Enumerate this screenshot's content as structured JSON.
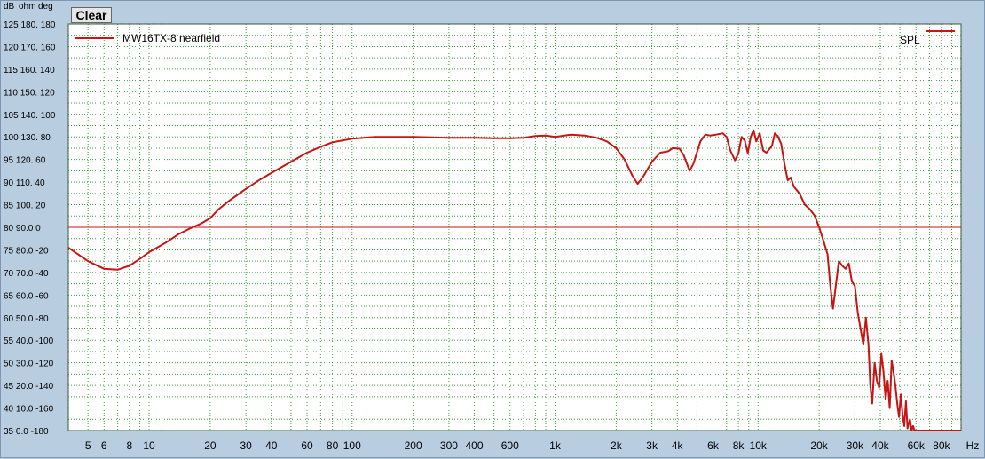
{
  "toolbar": {
    "clear_label": "Clear"
  },
  "axis_headers": {
    "db": "dB",
    "ohm": "ohm",
    "deg": "deg"
  },
  "colors": {
    "background": "#b9cde0",
    "grid": "#1a8a1a",
    "series": "#c81414",
    "reference_line": "#c81414"
  },
  "chart_data": {
    "type": "line",
    "x_scale": "log",
    "xlim": [
      4,
      100000
    ],
    "ylim": [
      35,
      125
    ],
    "grid": true,
    "legend_left": "MW16TX-8 nearfield",
    "legend_right": "SPL",
    "x_tick_labels": [
      {
        "value": 5,
        "label": "5"
      },
      {
        "value": 6,
        "label": "6"
      },
      {
        "value": 8,
        "label": "8"
      },
      {
        "value": 10,
        "label": "10"
      },
      {
        "value": 20,
        "label": "20"
      },
      {
        "value": 30,
        "label": "30"
      },
      {
        "value": 40,
        "label": "40"
      },
      {
        "value": 60,
        "label": "60"
      },
      {
        "value": 80,
        "label": "80"
      },
      {
        "value": 100,
        "label": "100"
      },
      {
        "value": 200,
        "label": "200"
      },
      {
        "value": 300,
        "label": "300"
      },
      {
        "value": 400,
        "label": "400"
      },
      {
        "value": 600,
        "label": "600"
      },
      {
        "value": 1000,
        "label": "1k"
      },
      {
        "value": 2000,
        "label": "2k"
      },
      {
        "value": 3000,
        "label": "3k"
      },
      {
        "value": 4000,
        "label": "4k"
      },
      {
        "value": 6000,
        "label": "6k"
      },
      {
        "value": 8000,
        "label": "8k"
      },
      {
        "value": 10000,
        "label": "10k"
      },
      {
        "value": 20000,
        "label": "20k"
      },
      {
        "value": 30000,
        "label": "30k"
      },
      {
        "value": 40000,
        "label": "40k"
      },
      {
        "value": 60000,
        "label": "60k"
      },
      {
        "value": 80000,
        "label": "80k"
      }
    ],
    "x_unit": "Hz",
    "y_tick_labels": [
      {
        "value": 125,
        "label": "125 180. 180"
      },
      {
        "value": 120,
        "label": "120 170. 160"
      },
      {
        "value": 115,
        "label": "115 160. 140"
      },
      {
        "value": 110,
        "label": "110 150. 120"
      },
      {
        "value": 105,
        "label": "105 140. 100"
      },
      {
        "value": 100,
        "label": "100 130. 80"
      },
      {
        "value": 95,
        "label": "95  120. 60"
      },
      {
        "value": 90,
        "label": "90  110. 40"
      },
      {
        "value": 85,
        "label": "85  100. 20"
      },
      {
        "value": 80,
        "label": "80  90.0 0"
      },
      {
        "value": 75,
        "label": "75  80.0 -20"
      },
      {
        "value": 70,
        "label": "70  70.0 -40"
      },
      {
        "value": 65,
        "label": "65  60.0 -60"
      },
      {
        "value": 60,
        "label": "60  50.0 -80"
      },
      {
        "value": 55,
        "label": "55  40.0 -100"
      },
      {
        "value": 50,
        "label": "50  30.0 -120"
      },
      {
        "value": 45,
        "label": "45  20.0 -140"
      },
      {
        "value": 40,
        "label": "40  10.0 -160"
      },
      {
        "value": 35,
        "label": "35  0.0  -180"
      }
    ],
    "reference_line_y": 80,
    "series": [
      {
        "name": "MW16TX-8 nearfield",
        "points": [
          [
            4,
            75.5
          ],
          [
            5,
            72.5
          ],
          [
            6,
            70.8
          ],
          [
            7,
            70.6
          ],
          [
            8,
            71.5
          ],
          [
            9,
            73
          ],
          [
            10,
            74.5
          ],
          [
            12,
            76.5
          ],
          [
            14,
            78.5
          ],
          [
            16,
            79.8
          ],
          [
            18,
            80.8
          ],
          [
            20,
            82
          ],
          [
            22,
            84
          ],
          [
            25,
            86
          ],
          [
            30,
            88.5
          ],
          [
            35,
            90.5
          ],
          [
            40,
            92
          ],
          [
            50,
            94.5
          ],
          [
            60,
            96.5
          ],
          [
            70,
            97.8
          ],
          [
            80,
            98.8
          ],
          [
            100,
            99.6
          ],
          [
            130,
            100
          ],
          [
            200,
            100
          ],
          [
            300,
            99.8
          ],
          [
            400,
            99.8
          ],
          [
            500,
            99.7
          ],
          [
            600,
            99.7
          ],
          [
            700,
            99.8
          ],
          [
            800,
            100.2
          ],
          [
            900,
            100.3
          ],
          [
            1000,
            100
          ],
          [
            1200,
            100.5
          ],
          [
            1400,
            100.3
          ],
          [
            1600,
            99.8
          ],
          [
            1800,
            99
          ],
          [
            2000,
            97.5
          ],
          [
            2200,
            95
          ],
          [
            2400,
            91.5
          ],
          [
            2550,
            89.6
          ],
          [
            2700,
            91
          ],
          [
            3000,
            94.5
          ],
          [
            3300,
            96.5
          ],
          [
            3600,
            96.8
          ],
          [
            3800,
            97.5
          ],
          [
            4100,
            97.4
          ],
          [
            4300,
            96
          ],
          [
            4600,
            92.5
          ],
          [
            4800,
            94
          ],
          [
            5200,
            99
          ],
          [
            5500,
            100.5
          ],
          [
            5800,
            100.3
          ],
          [
            6200,
            100.5
          ],
          [
            6700,
            100.8
          ],
          [
            7000,
            100
          ],
          [
            7300,
            97
          ],
          [
            7700,
            94.8
          ],
          [
            8000,
            96.3
          ],
          [
            8300,
            100
          ],
          [
            8600,
            99.2
          ],
          [
            8900,
            96.4
          ],
          [
            9200,
            100
          ],
          [
            9500,
            101.5
          ],
          [
            9800,
            99
          ],
          [
            10200,
            100.8
          ],
          [
            10600,
            97
          ],
          [
            11000,
            96.5
          ],
          [
            11700,
            98
          ],
          [
            12100,
            100.8
          ],
          [
            12500,
            100.2
          ],
          [
            13000,
            98.5
          ],
          [
            13500,
            94
          ],
          [
            14000,
            90.4
          ],
          [
            14500,
            91
          ],
          [
            15000,
            89
          ],
          [
            16000,
            87.5
          ],
          [
            17000,
            85
          ],
          [
            18000,
            84
          ],
          [
            19000,
            82.6
          ],
          [
            20000,
            80
          ],
          [
            21000,
            77
          ],
          [
            22000,
            74
          ],
          [
            22700,
            67
          ],
          [
            23400,
            62
          ],
          [
            24000,
            66
          ],
          [
            25000,
            72.5
          ],
          [
            26000,
            71.5
          ],
          [
            27000,
            70.8
          ],
          [
            28000,
            72
          ],
          [
            29000,
            68
          ],
          [
            30000,
            67
          ],
          [
            31000,
            61
          ],
          [
            32000,
            57.5
          ],
          [
            33000,
            54
          ],
          [
            34000,
            60
          ],
          [
            35000,
            54
          ],
          [
            35700,
            45
          ],
          [
            36500,
            41
          ],
          [
            37500,
            50
          ],
          [
            38500,
            46
          ],
          [
            39500,
            44.5
          ],
          [
            40500,
            52
          ],
          [
            41500,
            48
          ],
          [
            42500,
            42
          ],
          [
            43500,
            46
          ],
          [
            44500,
            40
          ],
          [
            45500,
            50.5
          ],
          [
            46500,
            48
          ],
          [
            47500,
            45
          ],
          [
            48500,
            41
          ],
          [
            49500,
            38
          ],
          [
            50500,
            43
          ],
          [
            51500,
            38.5
          ],
          [
            52500,
            36
          ],
          [
            53500,
            41.5
          ],
          [
            54500,
            35.5
          ],
          [
            56000,
            37.5
          ],
          [
            57000,
            35
          ],
          [
            58000,
            36
          ],
          [
            59000,
            35
          ],
          [
            100000,
            35
          ]
        ]
      }
    ]
  }
}
